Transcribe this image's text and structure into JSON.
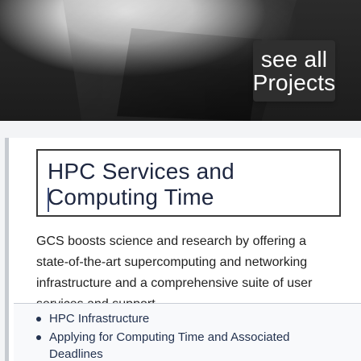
{
  "hero": {
    "see_all_line1": "see all",
    "see_all_line2": "Projects"
  },
  "section": {
    "title": "HPC Services and Computing Time",
    "description": "GCS boosts science and research by offering a state-of-the-art supercomputing and networking infrastructure and a comprehensive suite of user services and support.",
    "links": [
      "HPC Infrastructure",
      "Applying for Computing Time and Associated Deadlines"
    ]
  }
}
